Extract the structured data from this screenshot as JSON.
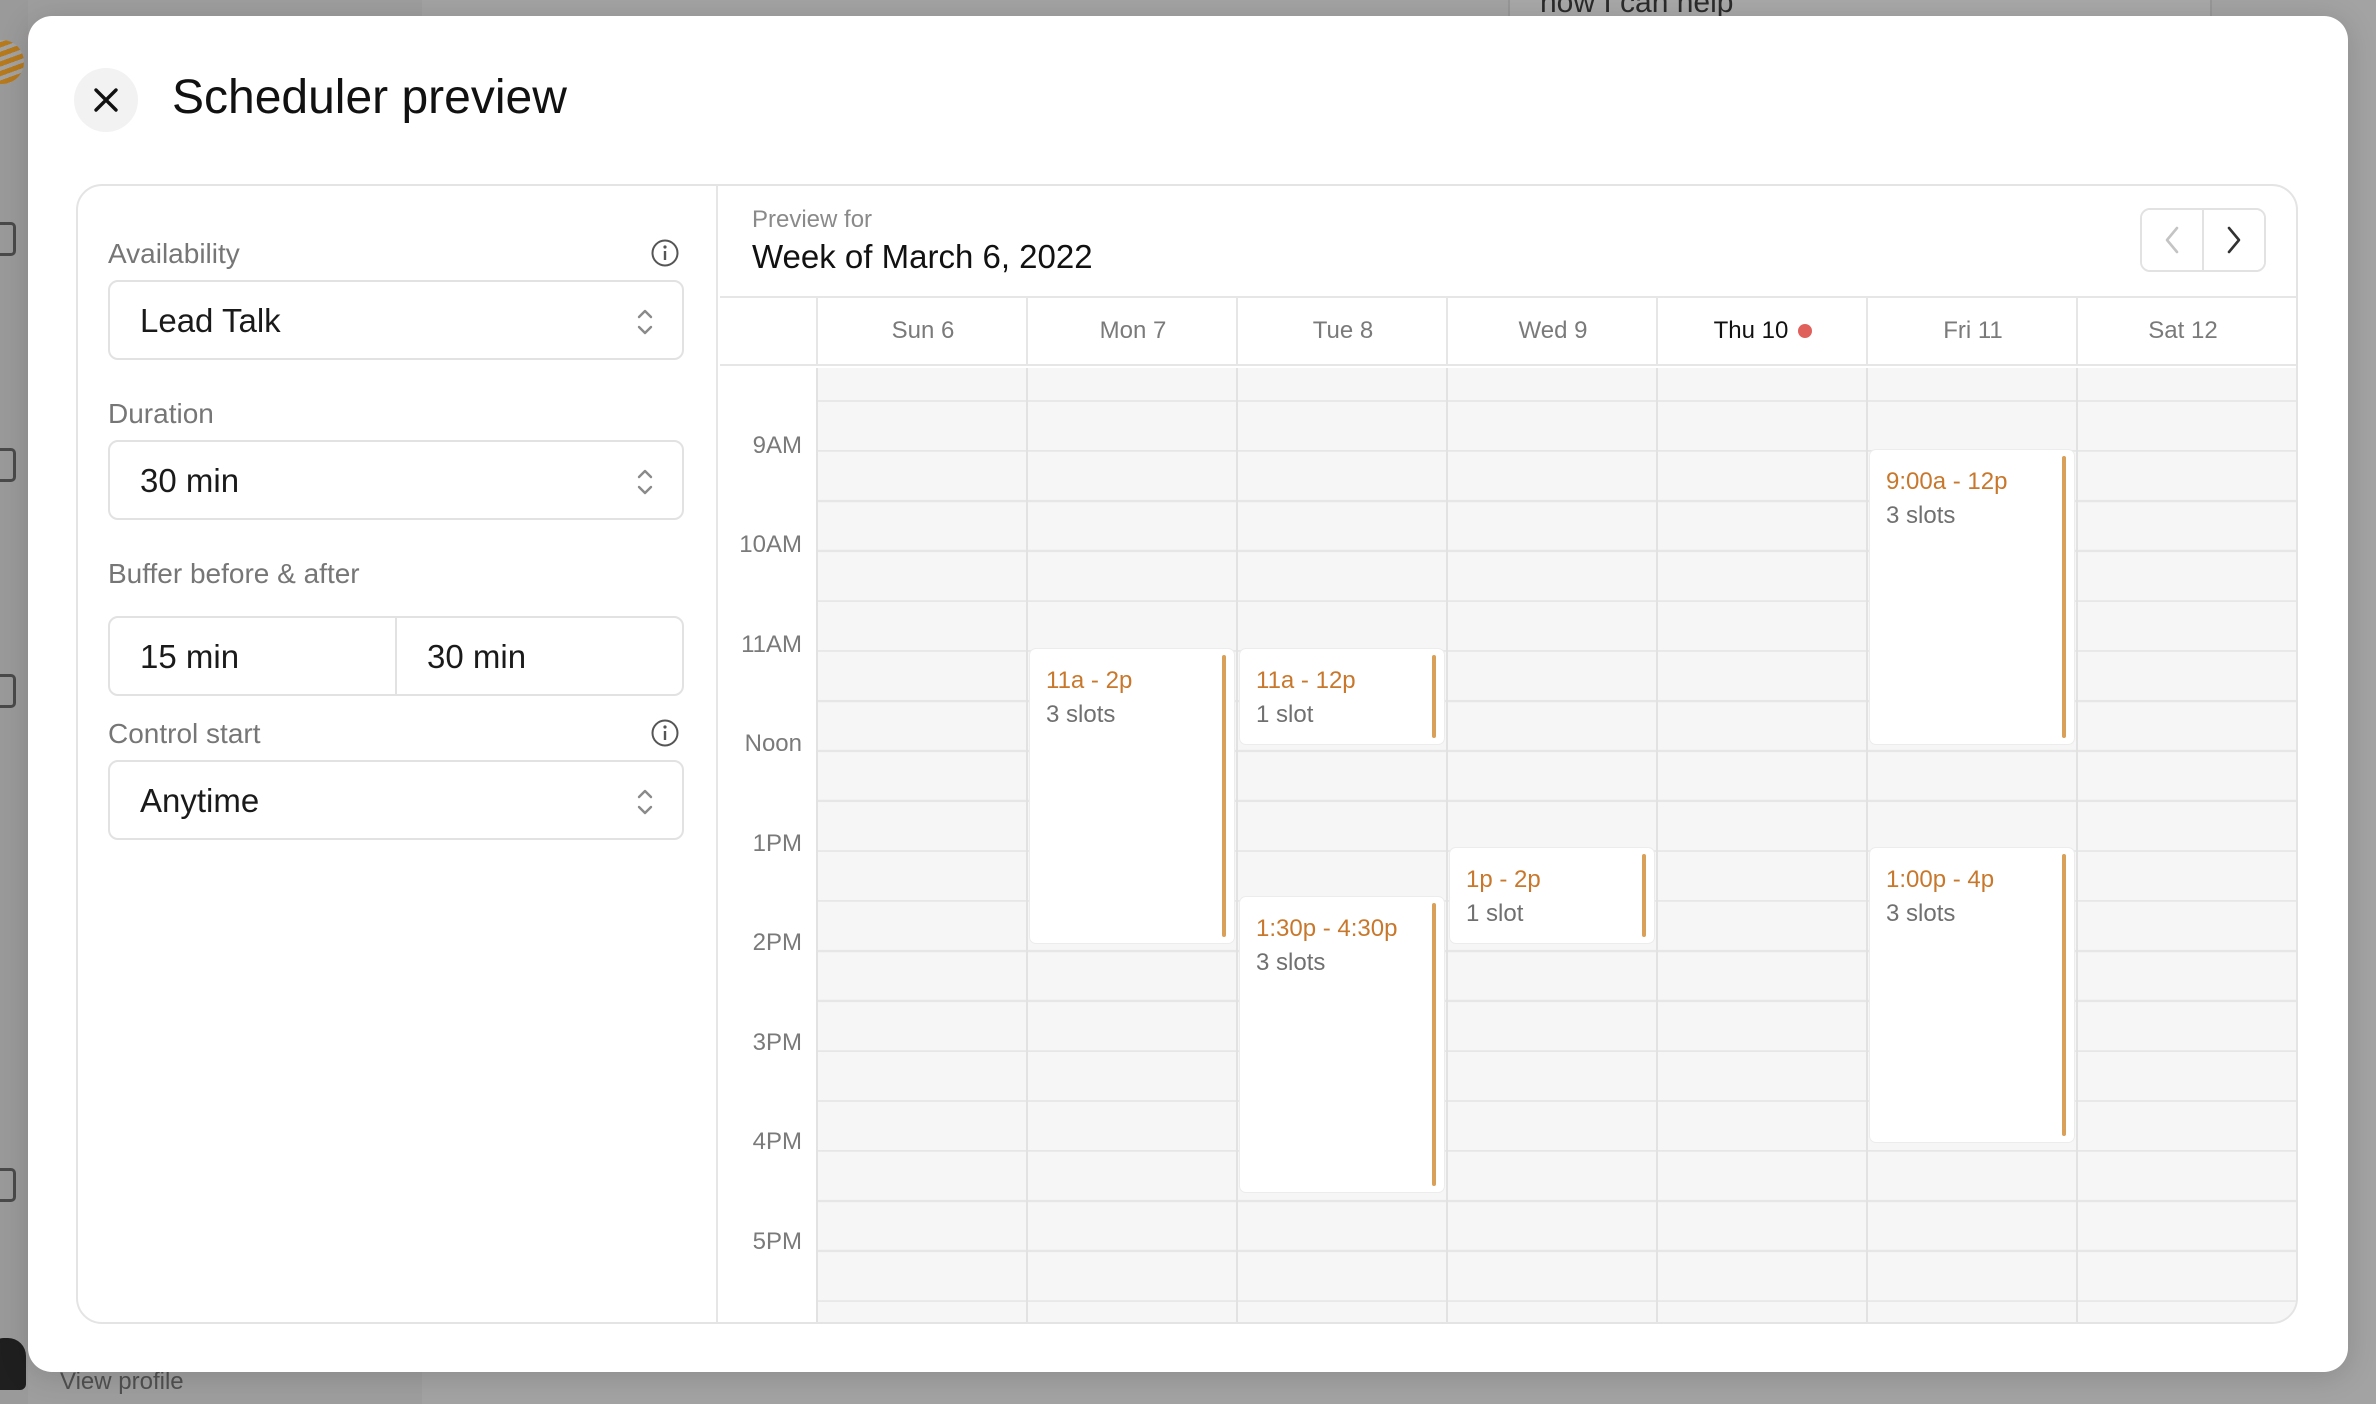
{
  "background": {
    "chat_snippet": "how I can help",
    "view_profile": "View profile"
  },
  "modal": {
    "title": "Scheduler preview",
    "close_icon": "close-icon"
  },
  "form": {
    "availability": {
      "label": "Availability",
      "value": "Lead Talk"
    },
    "duration": {
      "label": "Duration",
      "value": "30 min"
    },
    "buffer": {
      "label": "Buffer before & after",
      "before": "15 min",
      "after": "30 min"
    },
    "control_start": {
      "label": "Control start",
      "value": "Anytime"
    }
  },
  "calendar": {
    "preview_for": "Preview for",
    "week_title": "Week of March 6, 2022",
    "days": [
      {
        "label": "Sun 6",
        "today": false
      },
      {
        "label": "Mon 7",
        "today": false
      },
      {
        "label": "Tue 8",
        "today": false
      },
      {
        "label": "Wed 9",
        "today": false
      },
      {
        "label": "Thu 10",
        "today": true
      },
      {
        "label": "Fri 11",
        "today": false
      },
      {
        "label": "Sat 12",
        "today": false
      }
    ],
    "time_labels": [
      "9AM",
      "10AM",
      "11AM",
      "Noon",
      "1PM",
      "2PM",
      "3PM",
      "4PM",
      "5PM"
    ],
    "events": [
      {
        "day_index": 1,
        "start": 11,
        "end": 14,
        "time_text": "11a - 2p",
        "slots_text": "3 slots"
      },
      {
        "day_index": 2,
        "start": 11,
        "end": 12,
        "time_text": "11a - 12p",
        "slots_text": "1 slot"
      },
      {
        "day_index": 2,
        "start": 13.5,
        "end": 16.5,
        "time_text": "1:30p - 4:30p",
        "slots_text": "3 slots"
      },
      {
        "day_index": 3,
        "start": 13,
        "end": 14,
        "time_text": "1p - 2p",
        "slots_text": "1 slot"
      },
      {
        "day_index": 5,
        "start": 9,
        "end": 12,
        "time_text": "9:00a - 12p",
        "slots_text": "3 slots"
      },
      {
        "day_index": 5,
        "start": 13,
        "end": 16,
        "time_text": "1:00p - 4p",
        "slots_text": "3 slots"
      }
    ],
    "colors": {
      "event_time": "#c8782c",
      "event_bar": "#d9a05a",
      "today_dot": "#e0605c"
    }
  }
}
